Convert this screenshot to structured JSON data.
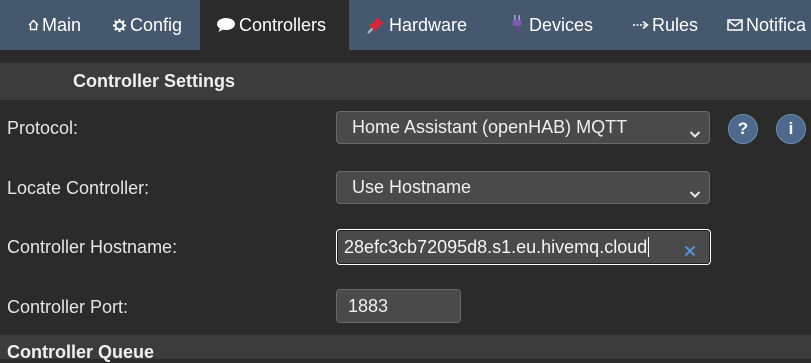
{
  "nav": {
    "tabs": [
      {
        "label": "Main",
        "icon": "home-icon"
      },
      {
        "label": "Config",
        "icon": "gear-icon"
      },
      {
        "label": "Controllers",
        "icon": "speech-bubble-icon",
        "active": true
      },
      {
        "label": "Hardware",
        "icon": "pushpin-icon"
      },
      {
        "label": "Devices",
        "icon": "plug-icon"
      },
      {
        "label": "Rules",
        "icon": "arrow-icon"
      },
      {
        "label": "Notifica",
        "icon": "envelope-icon"
      }
    ]
  },
  "section": {
    "title": "Controller Settings"
  },
  "form": {
    "protocol": {
      "label": "Protocol:",
      "value": "Home Assistant (openHAB) MQTT"
    },
    "locate": {
      "label": "Locate Controller:",
      "value": "Use Hostname"
    },
    "hostname": {
      "label": "Controller Hostname:",
      "value": "28efc3cb72095d8.s1.eu.hivemq.cloud"
    },
    "port": {
      "label": "Controller Port:",
      "value": "1883"
    }
  },
  "help_buttons": {
    "help": "?",
    "info": "i"
  },
  "next_section": {
    "title": "Controller Queue"
  },
  "colors": {
    "nav_bg": "#46586e",
    "page_bg": "#2b2b2b",
    "button": "#4d6a8c"
  }
}
